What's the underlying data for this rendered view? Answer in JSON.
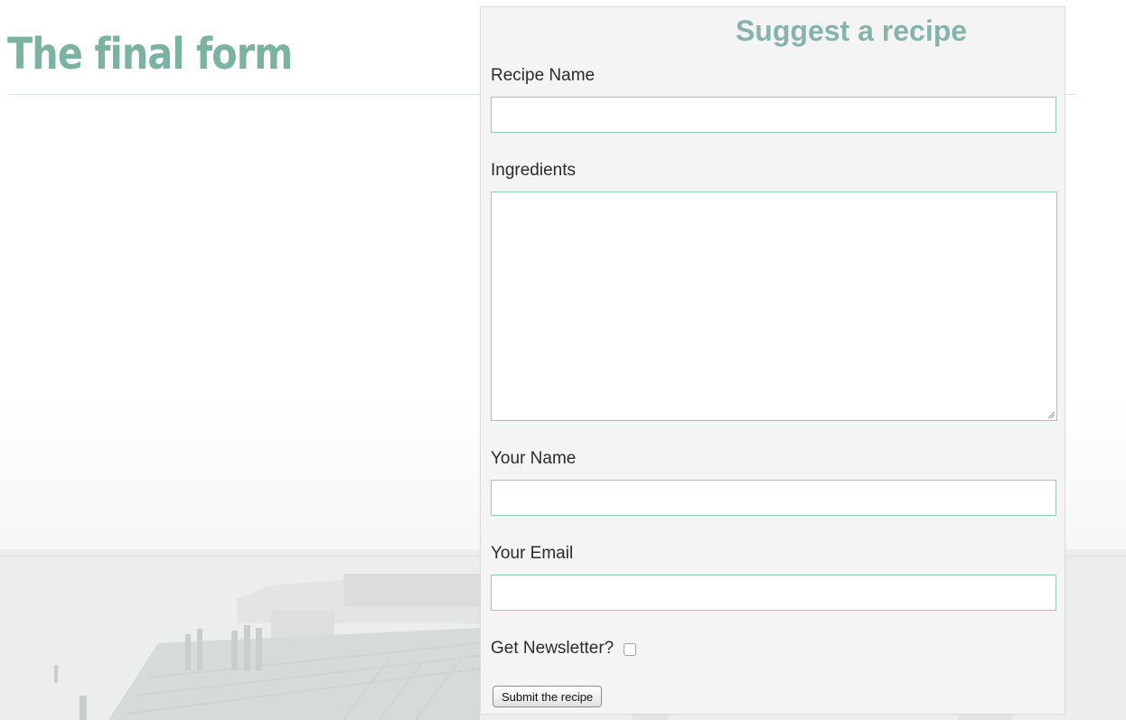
{
  "slide": {
    "title": "The final form"
  },
  "form": {
    "title": "Suggest a recipe",
    "recipe_name": {
      "label": "Recipe Name",
      "value": ""
    },
    "ingredients": {
      "label": "Ingredients",
      "value": ""
    },
    "your_name": {
      "label": "Your Name",
      "value": ""
    },
    "your_email": {
      "label": "Your Email",
      "value": ""
    },
    "newsletter": {
      "label": "Get Newsletter?",
      "checked": false
    },
    "submit_label": "Submit the recipe"
  },
  "colors": {
    "title_accent": "#7ab3a2",
    "form_heading": "#86b4ab",
    "input_border": "#9fc4bc",
    "panel_background": "#f3f4f3"
  },
  "icons": {
    "textarea_resize": "resize-grip-icon",
    "background_picture": "pier-photo"
  }
}
